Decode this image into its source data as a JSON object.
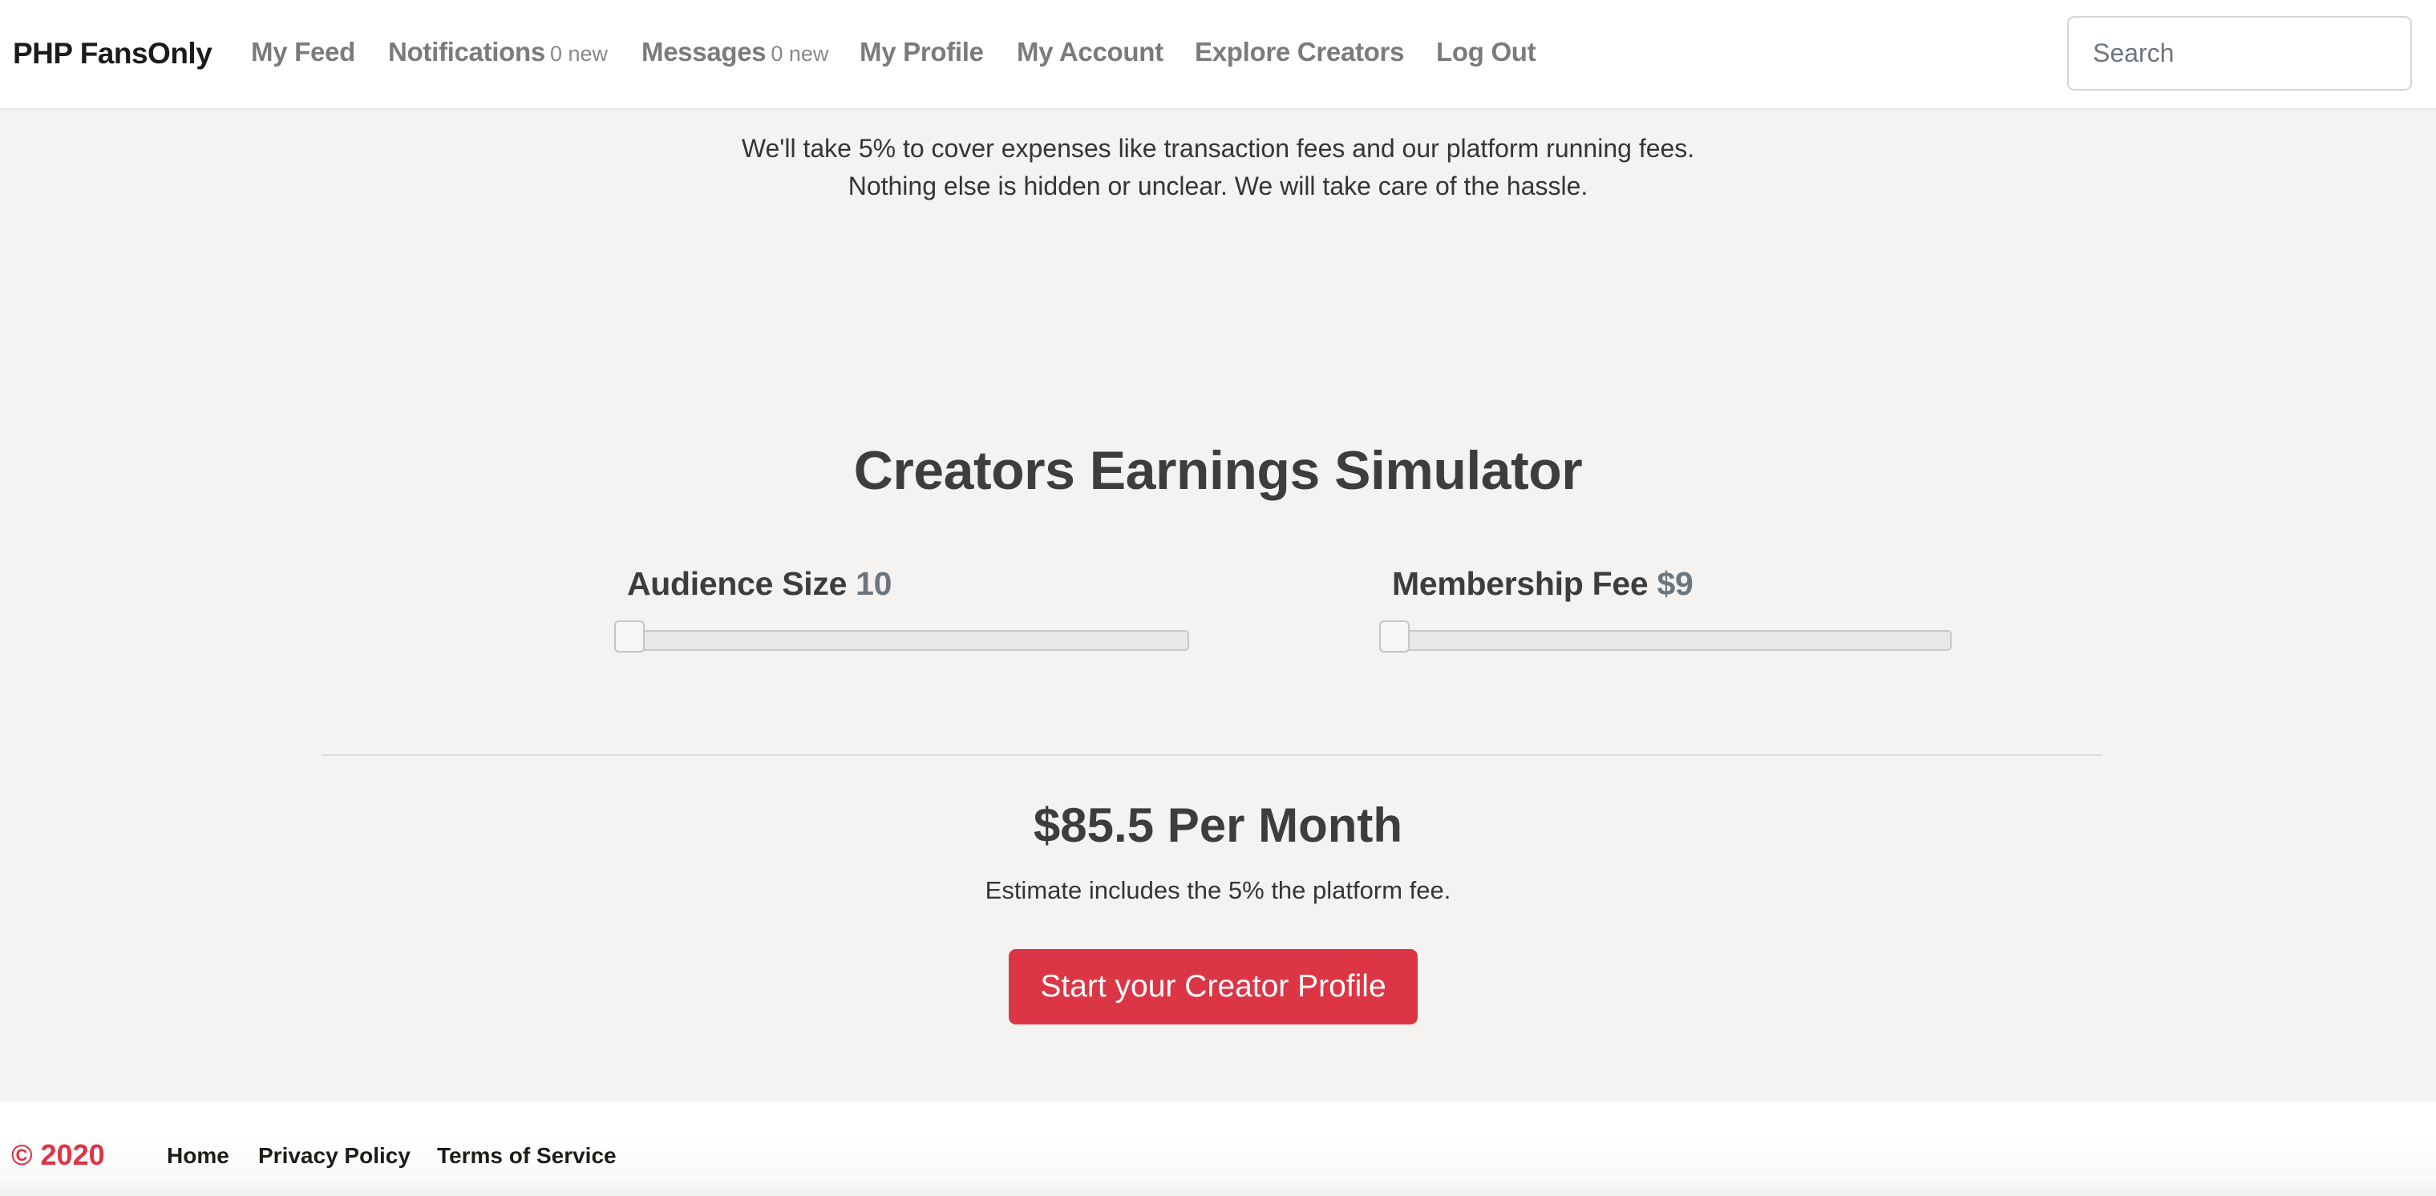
{
  "navbar": {
    "brand": "PHP FansOnly",
    "items": [
      {
        "label": "My Feed"
      },
      {
        "label": "Notifications",
        "badge": "0 new"
      },
      {
        "label": "Messages",
        "badge": "0 new"
      },
      {
        "label": "My Profile"
      },
      {
        "label": "My Account"
      },
      {
        "label": "Explore Creators"
      },
      {
        "label": "Log Out"
      }
    ],
    "search_placeholder": "Search"
  },
  "intro": {
    "line1": "We'll take 5% to cover expenses like transaction fees and our platform running fees.",
    "line2": "Nothing else is hidden or unclear. We will take care of the hassle."
  },
  "simulator": {
    "title": "Creators Earnings Simulator",
    "audience": {
      "label": "Audience Size",
      "value_display": "10",
      "value": 10
    },
    "fee": {
      "label": "Membership Fee",
      "value_display": "$9",
      "value": 9
    },
    "result": "$85.5 Per Month",
    "note": "Estimate includes the 5% the platform fee.",
    "cta_label": "Start your Creator Profile"
  },
  "footer": {
    "copyright": "© 2020",
    "links": [
      "Home",
      "Privacy Policy",
      "Terms of Service"
    ]
  },
  "colors": {
    "accent": "#dc3545",
    "background": "#f4f3f1",
    "text": "#3d3d3d",
    "muted": "#6c757d"
  }
}
